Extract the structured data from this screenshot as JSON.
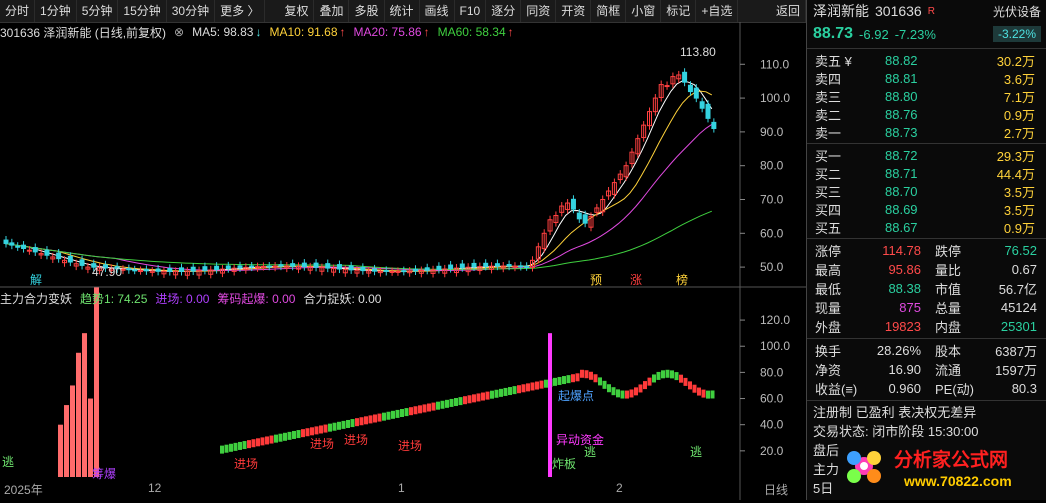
{
  "toolbar": {
    "buttons": [
      "分时",
      "1分钟",
      "5分钟",
      "15分钟",
      "30分钟",
      "更多 〉",
      "复权",
      "叠加",
      "多股",
      "统计",
      "画线",
      "F10",
      "逐分",
      "同资",
      "开资",
      "简框",
      "小窗",
      "标记",
      "+自选",
      "返回"
    ]
  },
  "main_header": {
    "code_name": "301636  泽润新能 (日线,前复权)",
    "ma5": "MA5: 98.83",
    "ma10": "MA10: 91.68",
    "ma20": "MA20: 75.86",
    "ma60": "MA60: 58.34",
    "arrow_down": "↓",
    "arrow_up": "↑"
  },
  "chart_data": [
    {
      "type": "candlestick",
      "title": "泽润新能 (日线,前复权)",
      "yticks": [
        "110.0",
        "100.0",
        "90.0",
        "80.0",
        "70.0",
        "60.0",
        "50.0"
      ],
      "ylim": [
        45,
        116
      ],
      "annotations": [
        "113.80",
        "47.90",
        "解",
        "预",
        "涨",
        "榜"
      ],
      "ma_series": [
        "MA5",
        "MA10",
        "MA20",
        "MA60"
      ]
    },
    {
      "type": "bar",
      "title": "主力合力变妖",
      "yticks": [
        "120.0",
        "100.0",
        "80.0",
        "60.0",
        "40.0",
        "20.0"
      ],
      "legend": [
        "趋势1: 74.25",
        "进场: 0.00",
        "筹码起爆: 0.00",
        "合力捉妖: 0.00"
      ],
      "annotations": [
        "逃",
        "筹爆",
        "进场",
        "进场",
        "进场",
        "进场",
        "起爆点",
        "异动资金",
        "炸板",
        "逃",
        "逃"
      ]
    }
  ],
  "sub_header": {
    "title": "主力合力变妖",
    "trend": "趋势1: 74.25",
    "entry": "进场: 0.00",
    "chip": "筹码起爆: 0.00",
    "catch": "合力捉妖: 0.00"
  },
  "date_axis": {
    "labels": [
      "2025年",
      "12",
      "1",
      "2",
      "日线"
    ]
  },
  "rpanel": {
    "name": "泽润新能",
    "code": "301636",
    "r_mark": "R",
    "sector": "光伏设备",
    "price": "88.73",
    "change": "-6.92",
    "change_pct": "-7.23%",
    "sector_pct": "-3.22%",
    "asks": [
      {
        "label": "卖五 ¥",
        "price": "88.82",
        "vol": "30.2万"
      },
      {
        "label": "卖四",
        "price": "88.81",
        "vol": "3.6万"
      },
      {
        "label": "卖三",
        "price": "88.80",
        "vol": "7.1万"
      },
      {
        "label": "卖二",
        "price": "88.76",
        "vol": "0.9万"
      },
      {
        "label": "卖一",
        "price": "88.73",
        "vol": "2.7万"
      }
    ],
    "bids": [
      {
        "label": "买一",
        "price": "88.72",
        "vol": "29.3万"
      },
      {
        "label": "买二",
        "price": "88.71",
        "vol": "44.4万"
      },
      {
        "label": "买三",
        "price": "88.70",
        "vol": "3.5万"
      },
      {
        "label": "买四",
        "price": "88.69",
        "vol": "3.5万"
      },
      {
        "label": "买五",
        "price": "88.67",
        "vol": "0.9万"
      }
    ],
    "stats": [
      {
        "k1": "涨停",
        "v1": "114.78",
        "c1": "red",
        "k2": "跌停",
        "v2": "76.52",
        "c2": "green"
      },
      {
        "k1": "最高",
        "v1": "95.86",
        "c1": "red",
        "k2": "量比",
        "v2": "0.67",
        "c2": "white"
      },
      {
        "k1": "最低",
        "v1": "88.38",
        "c1": "green",
        "k2": "市值",
        "v2": "56.7亿",
        "c2": "white"
      },
      {
        "k1": "现量",
        "v1": "875",
        "c1": "mag",
        "k2": "总量",
        "v2": "45124",
        "c2": "white"
      },
      {
        "k1": "外盘",
        "v1": "19823",
        "c1": "red",
        "k2": "内盘",
        "v2": "25301",
        "c2": "green"
      }
    ],
    "stats2": [
      {
        "k1": "换手",
        "v1": "28.26%",
        "k2": "股本",
        "v2": "6387万"
      },
      {
        "k1": "净资",
        "v1": "16.90",
        "k2": "流通",
        "v2": "1597万"
      },
      {
        "k1": "收益(≡)",
        "v1": "0.960",
        "k2": "PE(动)",
        "v2": "80.3"
      }
    ],
    "info1": "注册制 已盈利 表决权无差异",
    "info2": "交易状态: 闭市阶段 15:30:00",
    "info3": "盘后",
    "info4": "主力",
    "info5": "5日"
  },
  "watermark": {
    "text": "分析家公式网",
    "url": "www.70822.com"
  }
}
